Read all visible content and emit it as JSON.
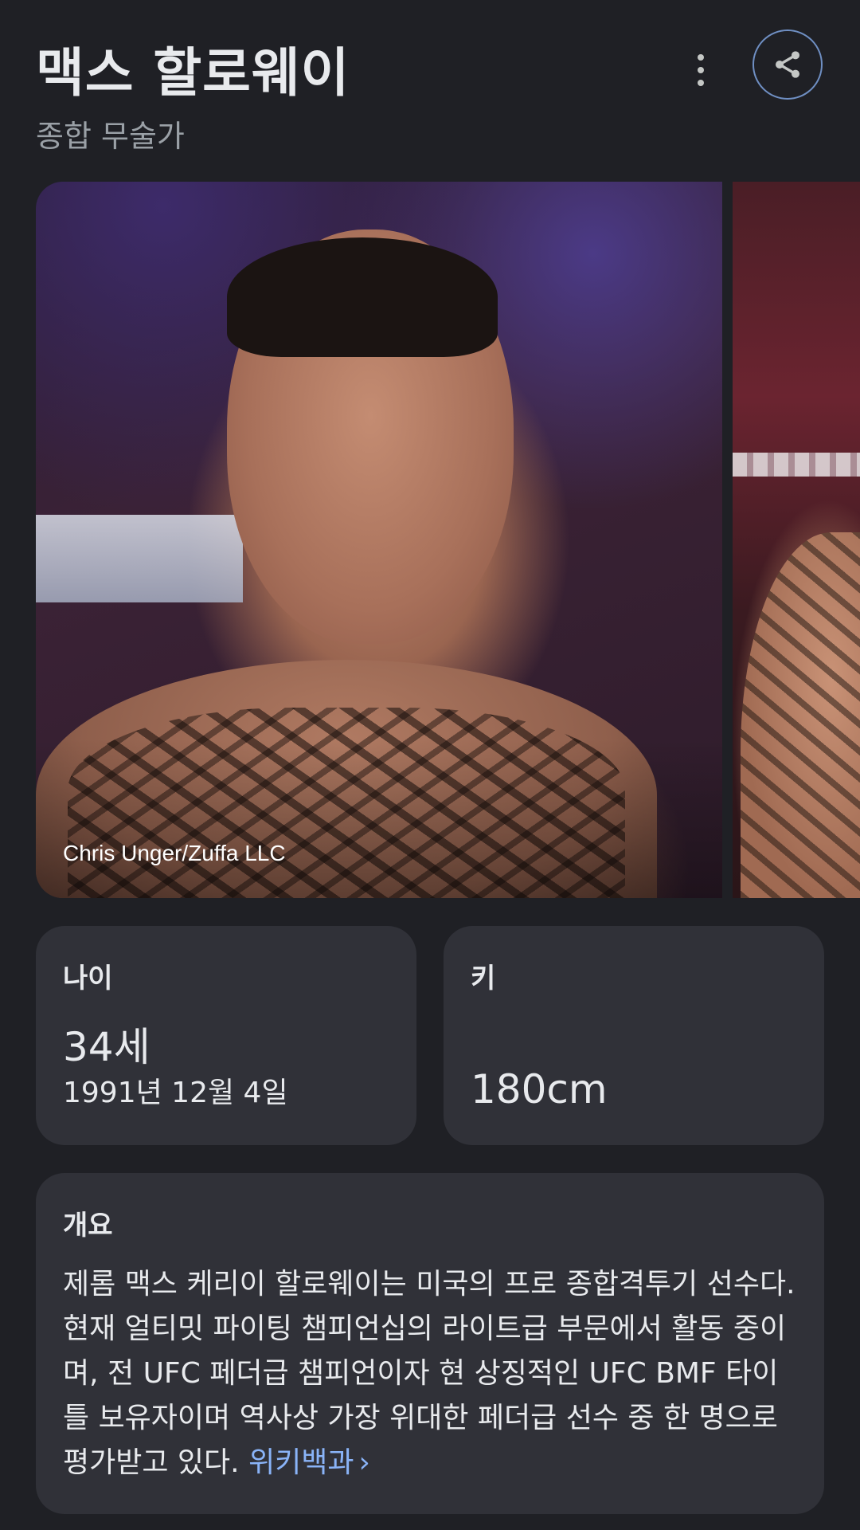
{
  "header": {
    "title": "맥스 할로웨이",
    "subtitle": "종합 무술가",
    "more_icon": "more-vert-icon",
    "share_icon": "share-icon"
  },
  "carousel": {
    "main_photo_credit": "Chris Unger/Zuffa LLC"
  },
  "age_card": {
    "label": "나이",
    "value": "34세",
    "birthdate": "1991년 12월 4일"
  },
  "height_card": {
    "label": "키",
    "value": "180cm"
  },
  "overview": {
    "title": "개요",
    "text": "제롬 맥스 케리이 할로웨이는 미국의 프로 종합격투기 선수다. 현재 얼티밋 파이팅 챔피언십의 라이트급 부문에서 활동 중이며, 전 UFC 페더급 챔피언이자 현 상징적인 UFC BMF 타이틀 보유자이며 역사상 가장 위대한 페더급 선수 중 한 명으로 평가받고 있다. ",
    "link_label": "위키백과",
    "link_chevron": "›"
  },
  "colors": {
    "background": "#1f2025",
    "card": "#303138",
    "link": "#8ab4f8",
    "share_border": "#6f8fc3"
  }
}
